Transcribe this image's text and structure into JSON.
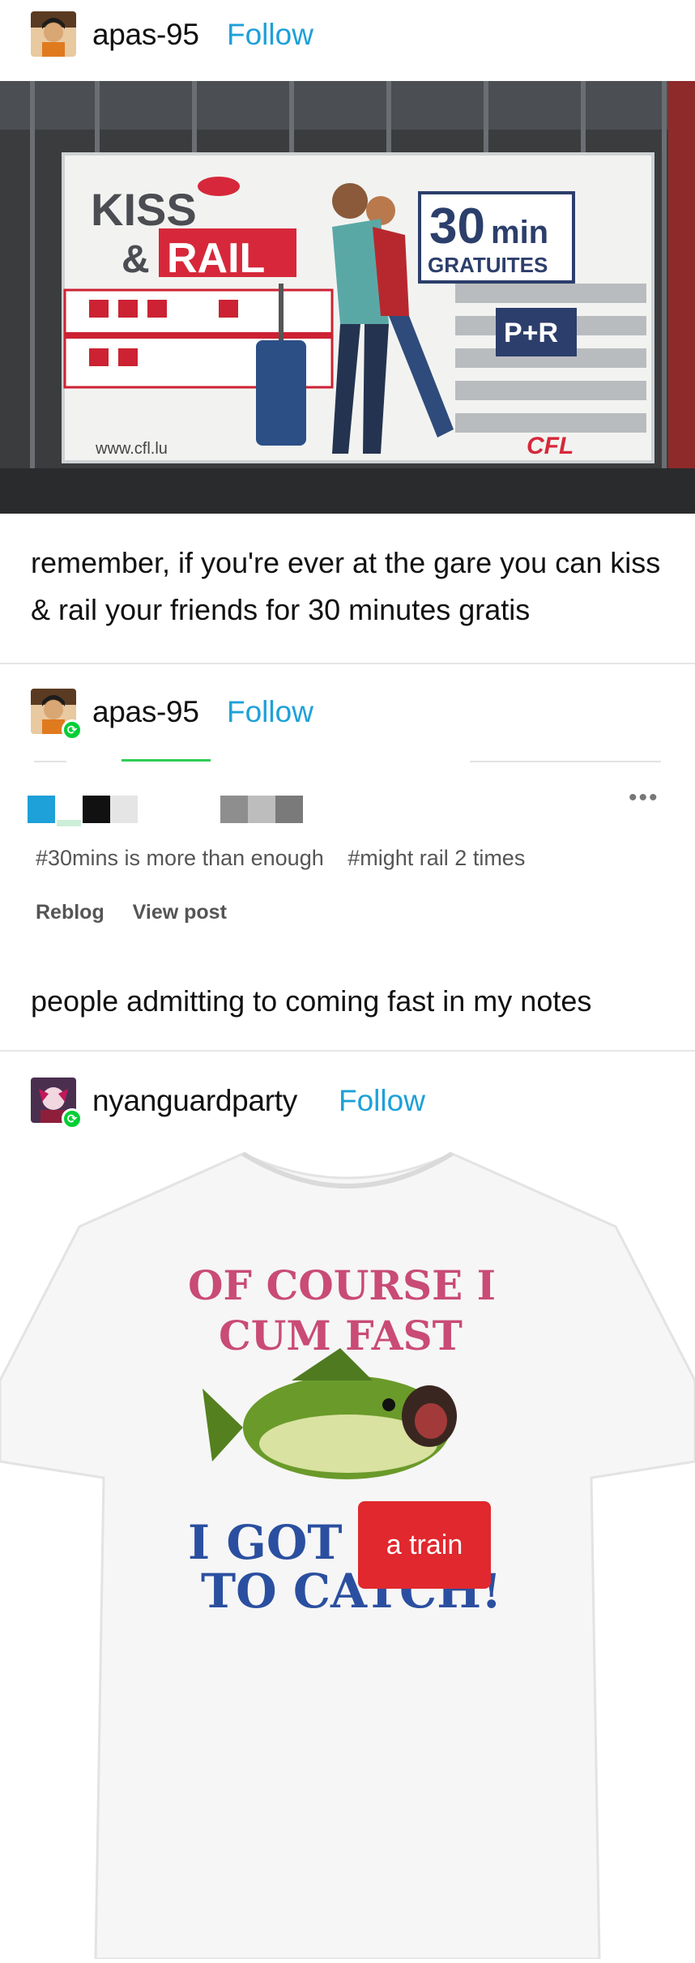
{
  "posts": [
    {
      "username": "apas-95",
      "follow_label": "Follow",
      "image": {
        "kind": "billboard",
        "sign_line1": "KISS",
        "sign_line2": "&",
        "sign_line3": "RAIL",
        "badge_number": "30",
        "badge_unit": "min",
        "badge_sub": "GRATUITES",
        "parking": "P+R",
        "url": "www.cfl.lu",
        "brand": "CFL"
      },
      "text": "remember, if you're ever at the gare you can kiss & rail your friends for 30 minutes gratis"
    },
    {
      "username": "apas-95",
      "follow_label": "Follow",
      "more_label": "•••",
      "tags": [
        "#30mins is more than enough",
        "#might rail 2 times"
      ],
      "actions": [
        "Reblog",
        "View post"
      ],
      "text": "people admitting to coming fast in my notes"
    },
    {
      "username": "nyanguardparty",
      "follow_label": "Follow",
      "image": {
        "kind": "t-shirt",
        "line1": "OF COURSE I",
        "line2": "CUM FAST",
        "line3": "I GOT",
        "line4": "TO CATCH!",
        "sticker": "a train"
      }
    }
  ],
  "colors": {
    "follow": "#1ea0d8",
    "reblog_badge": "#00cf35",
    "sticker": "#e0282e"
  }
}
